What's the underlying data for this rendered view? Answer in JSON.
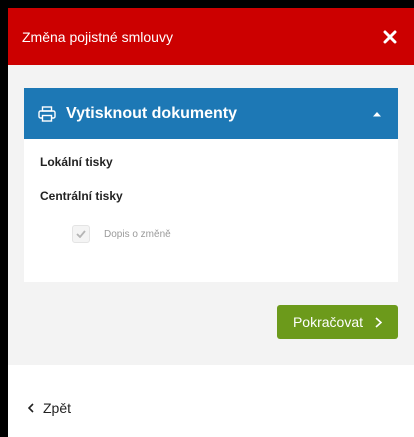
{
  "modal": {
    "title": "Změna pojistné smlouvy",
    "close_icon": "close-icon"
  },
  "panel": {
    "title": "Vytisknout dokumenty",
    "header_icon": "printer-icon",
    "toggle_icon": "caret-up-icon",
    "local_print_label": "Lokální tisky",
    "central_print_label": "Centrální tisky",
    "checkbox": {
      "label": "Dopis o změně",
      "checked": true,
      "disabled": true
    }
  },
  "actions": {
    "continue_label": "Pokračovat",
    "back_label": "Zpět"
  },
  "colors": {
    "header_red": "#cc0000",
    "panel_blue": "#1d78b5",
    "button_green": "#6c9a1b"
  }
}
